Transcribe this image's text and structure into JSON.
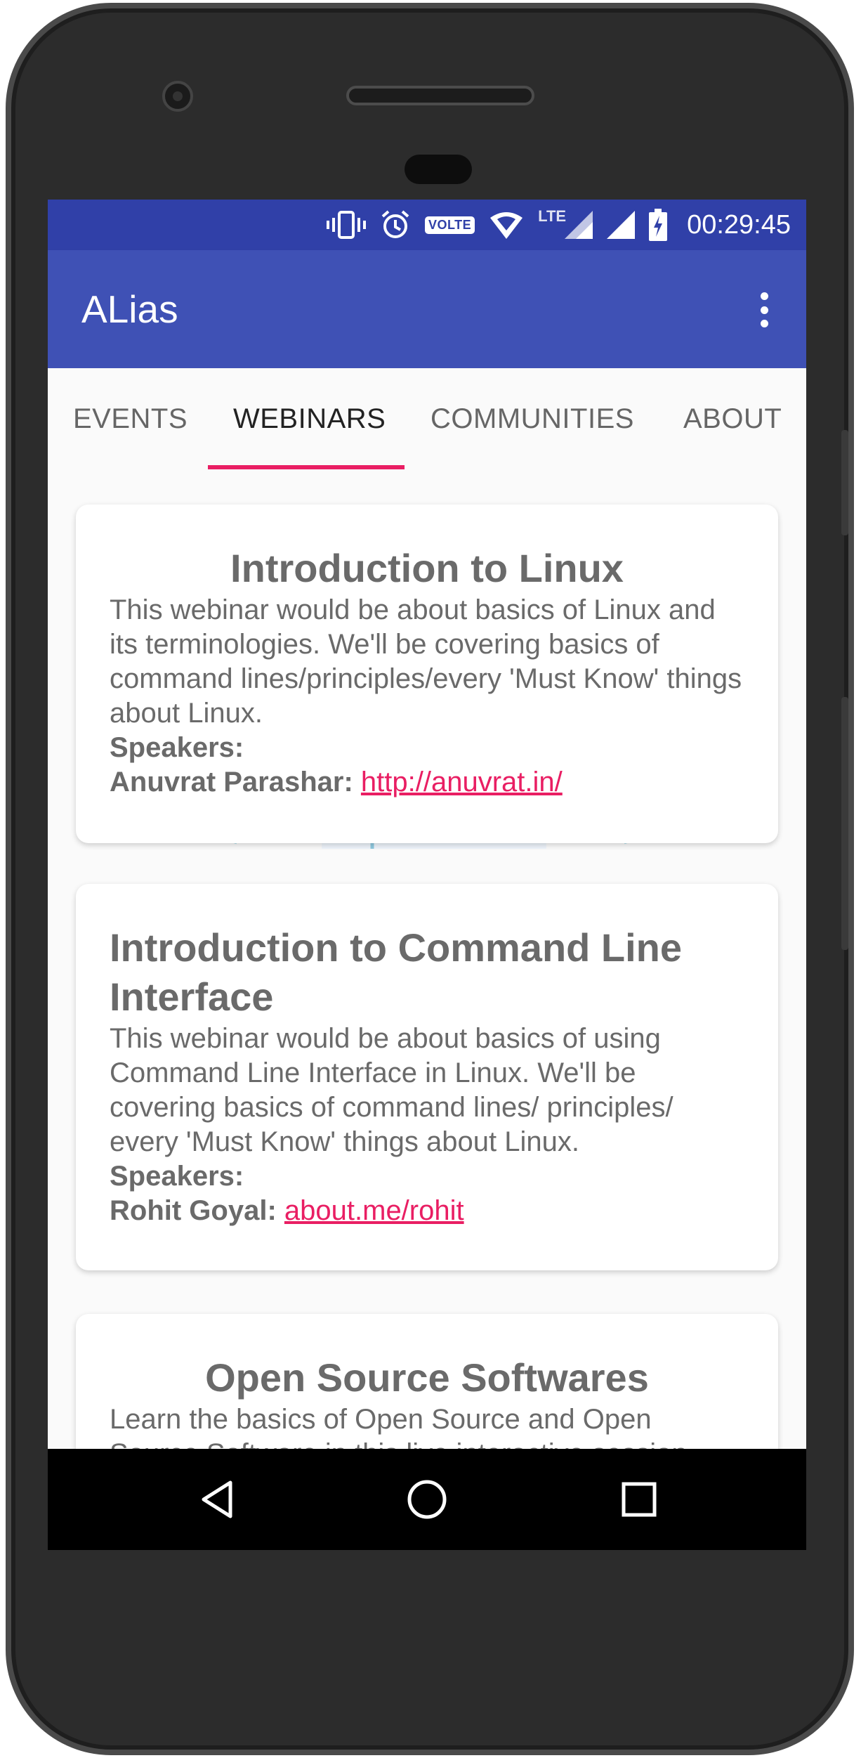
{
  "status_bar": {
    "time": "00:29:45",
    "volte_label": "VOLTE",
    "network_label": "LTE",
    "icons": [
      "vibrate-icon",
      "alarm-icon",
      "volte-icon",
      "wifi-icon",
      "signal-icon",
      "signal-icon",
      "battery-charging-icon"
    ]
  },
  "app_bar": {
    "title": "ALias",
    "menu_icon": "overflow-menu-icon"
  },
  "tabs": [
    {
      "label": "EVENTS",
      "active": false
    },
    {
      "label": "WEBINARS",
      "active": true
    },
    {
      "label": "COMMUNITIES",
      "active": false
    },
    {
      "label": "ABOUT",
      "active": false
    }
  ],
  "webinars": [
    {
      "title": "Introduction to Linux",
      "description": "This webinar would be about basics of Linux and its terminologies. We'll be covering basics of command lines/principles/every 'Must Know' things about Linux.",
      "speakers_label": "Speakers:",
      "speaker_name": "Anuvrat Parashar:",
      "speaker_link": "http://anuvrat.in/"
    },
    {
      "title": "Introduction to Command Line Interface",
      "description": "This webinar would be about basics of using Command Line Interface in Linux. We'll be covering basics of command lines/ principles/ every 'Must Know' things about Linux.",
      "speakers_label": "Speakers:",
      "speaker_name": "Rohit Goyal:",
      "speaker_link": "about.me/rohit"
    },
    {
      "title": "Open Source Softwares",
      "description": "Learn the basics of Open Source and Open Source Software in this live interactive session"
    }
  ],
  "nav_bar": {
    "back_icon": "back-icon",
    "home_icon": "home-icon",
    "recents_icon": "recents-icon"
  },
  "colors": {
    "status_bar": "#3040a8",
    "app_bar": "#3f51b5",
    "accent": "#e91e63"
  }
}
